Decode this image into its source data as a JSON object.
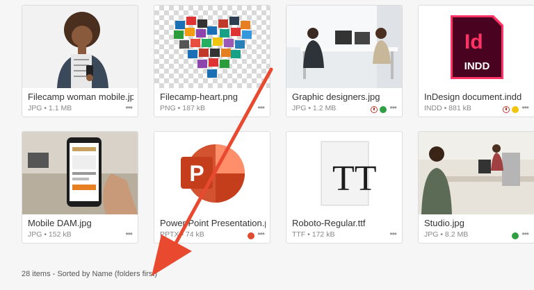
{
  "files": [
    {
      "name": "Filecamp woman mobile.jpg",
      "meta": "JPG • 1.1 MB",
      "status": []
    },
    {
      "name": "Filecamp-heart.png",
      "meta": "PNG • 187 kB",
      "status": []
    },
    {
      "name": "Graphic designers.jpg",
      "meta": "JPG • 1.2 MB",
      "status": [
        "clock",
        "#2ea043"
      ]
    },
    {
      "name": "InDesign document.indd",
      "meta": "INDD • 881 kB",
      "status": [
        "clock",
        "#f1c40f"
      ]
    },
    {
      "name": "Mobile DAM.jpg",
      "meta": "JPG • 152 kB",
      "status": []
    },
    {
      "name": "Power Point Presentation.pptx",
      "meta": "PPTX • 74 kB",
      "status": [
        "#e04a2f"
      ]
    },
    {
      "name": "Roboto-Regular.ttf",
      "meta": "TTF • 172 kB",
      "status": []
    },
    {
      "name": "Studio.jpg",
      "meta": "JPG • 8.2 MB",
      "status": [
        "#2ea043"
      ]
    }
  ],
  "more_glyph": "•••",
  "indesign_icon": {
    "letters": "Id",
    "ext": "INDD",
    "color": "#49021f",
    "accent": "#ff3366"
  },
  "font_preview": {
    "letters": "TT"
  },
  "footer": {
    "text": "28 items - Sorted by Name (folders first)"
  },
  "colors": {
    "annotation_arrow": "#e8492f"
  }
}
